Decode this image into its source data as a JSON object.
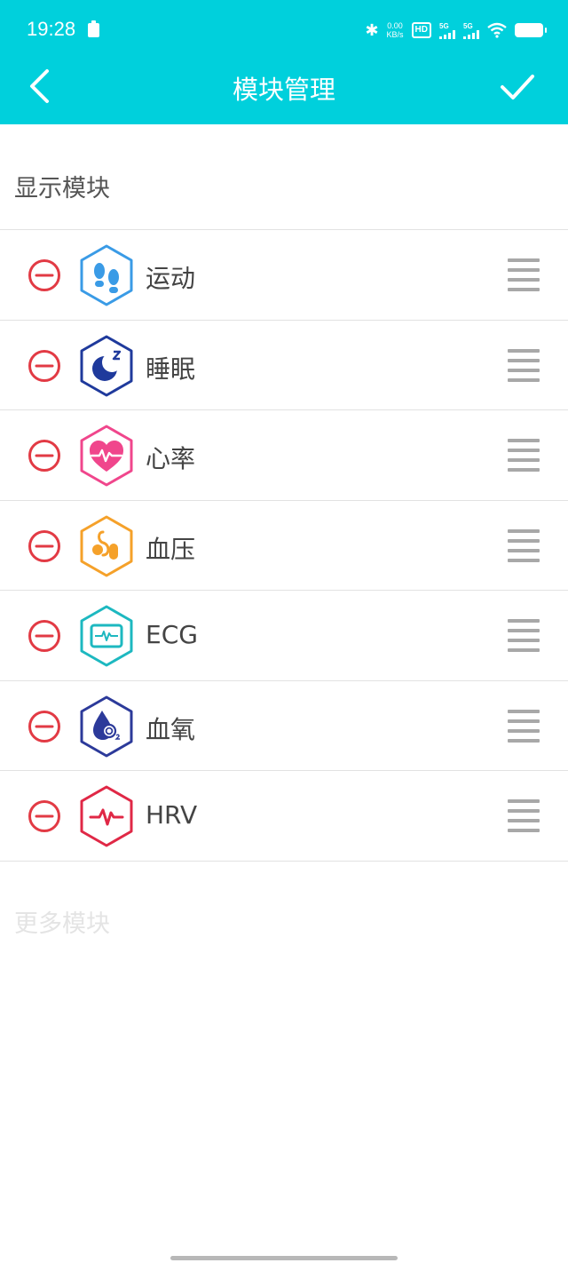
{
  "status_bar": {
    "time": "19:28",
    "speed_value": "0.00",
    "speed_unit": "KB/s",
    "hd_badge": "HD",
    "sim1_label": "5G",
    "sim2_label": "5G"
  },
  "header": {
    "title": "模块管理",
    "back_icon": "chevron-left-icon",
    "confirm_icon": "check-icon",
    "bar_color": "#00d0dc"
  },
  "sections": {
    "shown_title": "显示模块",
    "more_title": "更多模块"
  },
  "modules": [
    {
      "label": "运动",
      "icon": "footsteps-icon",
      "color": "#3a9be6"
    },
    {
      "label": "睡眠",
      "icon": "moon-sleep-icon",
      "color": "#1f3a9c"
    },
    {
      "label": "心率",
      "icon": "heart-rate-icon",
      "color": "#f0468c"
    },
    {
      "label": "血压",
      "icon": "blood-pressure-icon",
      "color": "#f5a12a"
    },
    {
      "label": "ECG",
      "icon": "ecg-icon",
      "color": "#1db8c0"
    },
    {
      "label": "血氧",
      "icon": "blood-oxygen-icon",
      "color": "#2c3a9a"
    },
    {
      "label": "HRV",
      "icon": "hrv-icon",
      "color": "#e02846"
    }
  ],
  "colors": {
    "remove_red": "#e23a44",
    "handle_grey": "#a8a8a8"
  }
}
